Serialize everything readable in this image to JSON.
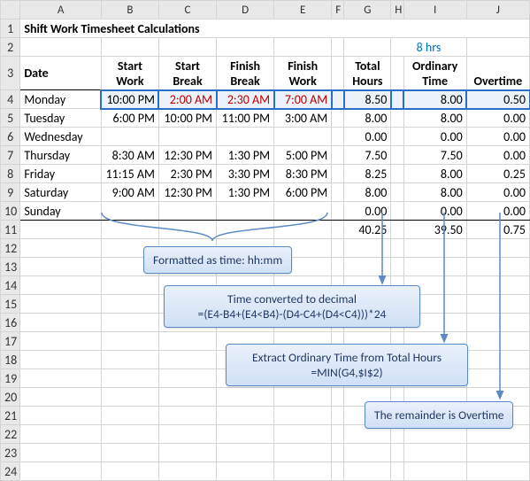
{
  "title": "Shift Work Timesheet Calculations",
  "ordinary_limit": "8 hrs",
  "columns": [
    "",
    "A",
    "B",
    "C",
    "D",
    "E",
    "F",
    "G",
    "H",
    "I",
    "J"
  ],
  "headers": {
    "date": "Date",
    "start_work_1": "Start",
    "start_work_2": "Work",
    "start_break_1": "Start",
    "start_break_2": "Break",
    "finish_break_1": "Finish",
    "finish_break_2": "Break",
    "finish_work_1": "Finish",
    "finish_work_2": "Work",
    "total_1": "Total",
    "total_2": "Hours",
    "ord_1": "Ordinary",
    "ord_2": "Time",
    "overtime": "Overtime"
  },
  "rows": [
    {
      "r": "4",
      "day": "Monday",
      "sw": "10:00 PM",
      "sb": "2:00 AM",
      "fb": "2:30 AM",
      "fw": "7:00 AM",
      "total": "8.50",
      "ord": "8.00",
      "ot": "0.50",
      "red": true
    },
    {
      "r": "5",
      "day": "Tuesday",
      "sw": "6:00 PM",
      "sb": "10:00 PM",
      "fb": "11:00 PM",
      "fw": "3:00 AM",
      "total": "8.00",
      "ord": "8.00",
      "ot": "0.00"
    },
    {
      "r": "6",
      "day": "Wednesday",
      "sw": "",
      "sb": "",
      "fb": "",
      "fw": "",
      "total": "0.00",
      "ord": "0.00",
      "ot": "0.00"
    },
    {
      "r": "7",
      "day": "Thursday",
      "sw": "8:30 AM",
      "sb": "12:30 PM",
      "fb": "1:30 PM",
      "fw": "5:00 PM",
      "total": "7.50",
      "ord": "7.50",
      "ot": "0.00"
    },
    {
      "r": "8",
      "day": "Friday",
      "sw": "11:15 AM",
      "sb": "2:30 PM",
      "fb": "3:30 PM",
      "fw": "8:30 PM",
      "total": "8.25",
      "ord": "8.00",
      "ot": "0.25"
    },
    {
      "r": "9",
      "day": "Saturday",
      "sw": "9:00 AM",
      "sb": "12:30 PM",
      "fb": "1:30 PM",
      "fw": "6:00 PM",
      "total": "8.00",
      "ord": "8.00",
      "ot": "0.00"
    },
    {
      "r": "10",
      "day": "Sunday",
      "sw": "",
      "sb": "",
      "fb": "",
      "fw": "",
      "total": "0.00",
      "ord": "0.00",
      "ot": "0.00"
    }
  ],
  "totals": {
    "r": "11",
    "total": "40.25",
    "ord": "39.50",
    "ot": "0.75"
  },
  "empty_rows": [
    "12",
    "13",
    "14",
    "15",
    "16",
    "17",
    "18",
    "19",
    "20",
    "21",
    "22",
    "23",
    "24"
  ],
  "callouts": {
    "fmt": "Formatted as time: hh:mm",
    "conv_1": "Time converted to decimal",
    "conv_2": "=(E4-B4+(E4<B4)-(D4-C4+(D4<C4)))*24",
    "ord_1": "Extract Ordinary Time from Total Hours",
    "ord_2": "=MIN(G4,$I$2)",
    "ot": "The remainder is Overtime"
  },
  "chart_data": {
    "type": "table",
    "title": "Shift Work Timesheet Calculations",
    "ordinary_limit_hours": 8,
    "columns": [
      "Date",
      "Start Work",
      "Start Break",
      "Finish Break",
      "Finish Work",
      "Total Hours",
      "Ordinary Time",
      "Overtime"
    ],
    "rows": [
      [
        "Monday",
        "10:00 PM",
        "2:00 AM",
        "2:30 AM",
        "7:00 AM",
        8.5,
        8.0,
        0.5
      ],
      [
        "Tuesday",
        "6:00 PM",
        "10:00 PM",
        "11:00 PM",
        "3:00 AM",
        8.0,
        8.0,
        0.0
      ],
      [
        "Wednesday",
        "",
        "",
        "",
        "",
        0.0,
        0.0,
        0.0
      ],
      [
        "Thursday",
        "8:30 AM",
        "12:30 PM",
        "1:30 PM",
        "5:00 PM",
        7.5,
        7.5,
        0.0
      ],
      [
        "Friday",
        "11:15 AM",
        "2:30 PM",
        "3:30 PM",
        "8:30 PM",
        8.25,
        8.0,
        0.25
      ],
      [
        "Saturday",
        "9:00 AM",
        "12:30 PM",
        "1:30 PM",
        "6:00 PM",
        8.0,
        8.0,
        0.0
      ],
      [
        "Sunday",
        "",
        "",
        "",
        "",
        0.0,
        0.0,
        0.0
      ]
    ],
    "totals": [
      40.25,
      39.5,
      0.75
    ],
    "formulas": {
      "total_hours": "=(E4-B4+(E4<B4)-(D4-C4+(D4<C4)))*24",
      "ordinary_time": "=MIN(G4,$I$2)"
    }
  }
}
